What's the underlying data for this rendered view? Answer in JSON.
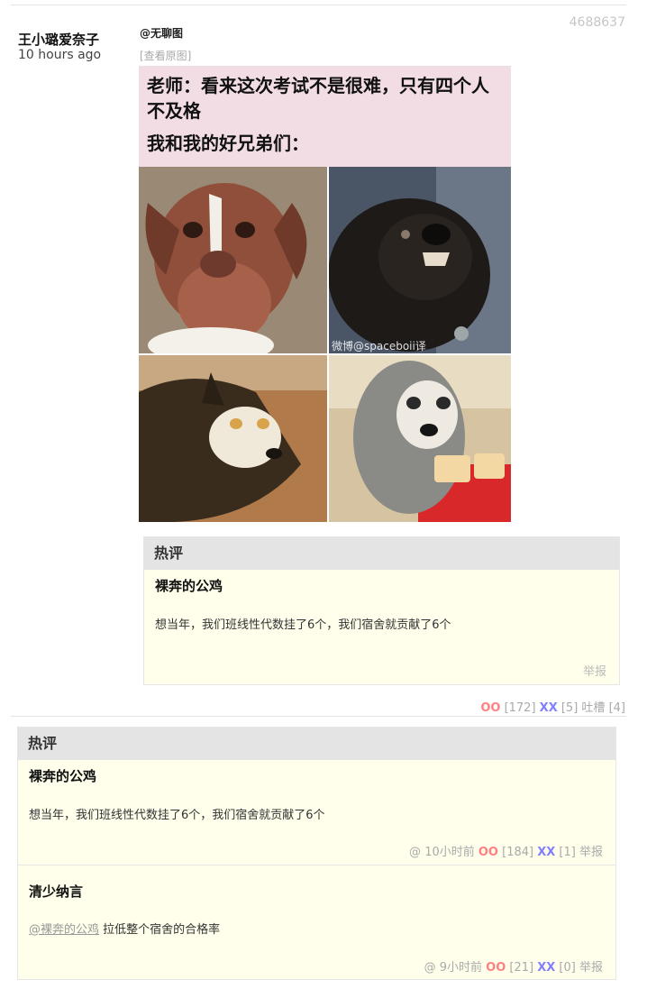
{
  "post": {
    "author": "王小璐爱奈子",
    "time": "10 hours ago",
    "id": "4688637",
    "tag": "@无聊图",
    "view_original": "[查看原图]",
    "image": {
      "caption_line1": "老师：看来这次考试不是很难，只有四个人",
      "caption_line2": "不及格",
      "caption_line3": "我和我的好兄弟们：",
      "watermark": "微博@spaceboii译"
    },
    "hot": {
      "header": "热评",
      "name": "裸奔的公鸡",
      "text": "想当年，我们班线性代数挂了6个，我们宿舍就贡献了6个",
      "report": "举报"
    },
    "votes": {
      "oo": "OO",
      "oo_count": "[172]",
      "xx": "XX",
      "xx_count": "[5]",
      "tucao": "吐槽",
      "tucao_count": "[4]"
    }
  },
  "comments": {
    "header": "热评",
    "items": [
      {
        "name": "裸奔的公鸡",
        "text": "想当年，我们班线性代数挂了6个，我们宿舍就贡献了6个",
        "at": "@",
        "time": "10小时前",
        "oo": "OO",
        "oo_count": "[184]",
        "xx": "XX",
        "xx_count": "[1]",
        "report": "举报"
      },
      {
        "name": "清少纳言",
        "mention": "@裸奔的公鸡",
        "text": "拉低整个宿舍的合格率",
        "at": "@",
        "time": "9小时前",
        "oo": "OO",
        "oo_count": "[21]",
        "xx": "XX",
        "xx_count": "[0]",
        "report": "举报"
      }
    ]
  }
}
